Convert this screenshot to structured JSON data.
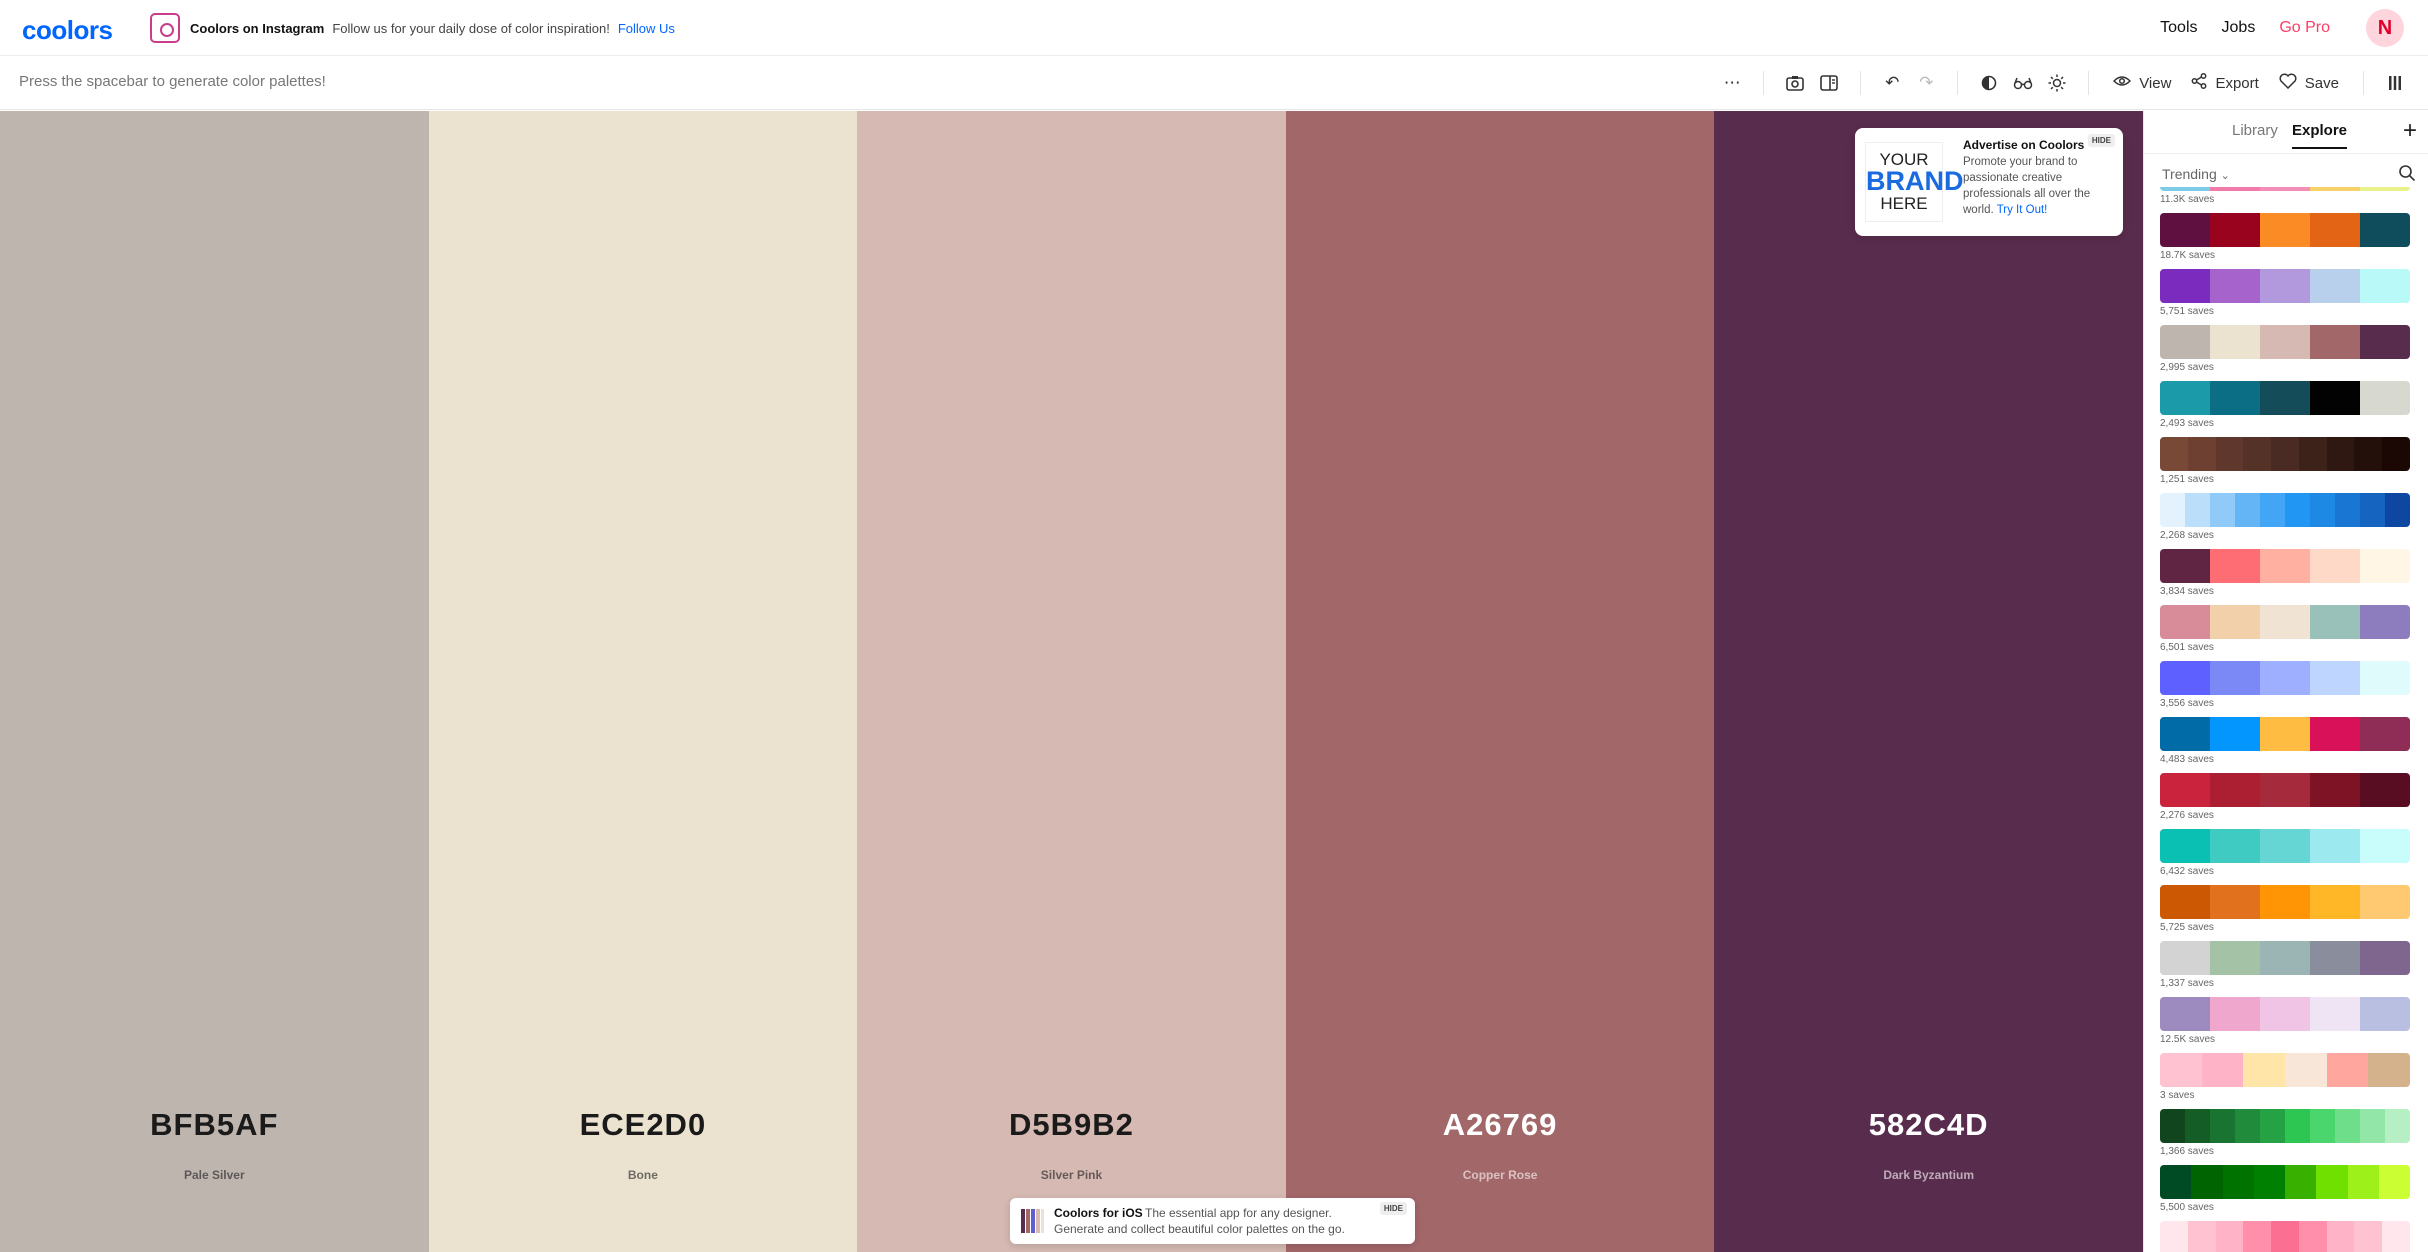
{
  "header": {
    "logo": "coolors",
    "promo_title": "Coolors on Instagram",
    "promo_text": "Follow us for your daily dose of color inspiration!",
    "promo_link": "Follow Us",
    "nav": [
      "Tools",
      "Jobs",
      "Go Pro"
    ],
    "avatar_initial": "N"
  },
  "toolbar": {
    "hint": "Press the spacebar to generate color palettes!",
    "view_label": "View",
    "export_label": "Export",
    "save_label": "Save"
  },
  "palette": [
    {
      "hex": "BFB5AF",
      "name": "Pale Silver",
      "color": "#BFB5AF",
      "text": "#1a1a1a"
    },
    {
      "hex": "ECE2D0",
      "name": "Bone",
      "color": "#ECE2D0",
      "text": "#1a1a1a"
    },
    {
      "hex": "D5B9B2",
      "name": "Silver Pink",
      "color": "#D5B9B2",
      "text": "#1a1a1a"
    },
    {
      "hex": "A26769",
      "name": "Copper Rose",
      "color": "#A26769",
      "text": "#ffffff"
    },
    {
      "hex": "582C4D",
      "name": "Dark Byzantium",
      "color": "#582C4D",
      "text": "#ffffff"
    }
  ],
  "ad": {
    "hide": "HIDE",
    "brand_line1": "YOUR",
    "brand_line2": "BRAND",
    "brand_line3": "HERE",
    "title": "Advertise on Coolors",
    "text": "Promote your brand to passionate creative professionals all over the world.",
    "link": "Try It Out!"
  },
  "ios_banner": {
    "title": "Coolors for iOS",
    "text1": "The essential app for any designer.",
    "text2": "Generate and collect beautiful color palettes on the go.",
    "hide": "HIDE"
  },
  "panel": {
    "tabs": [
      "Library",
      "Explore"
    ],
    "active_tab": "Explore",
    "filter": "Trending",
    "palettes": [
      {
        "saves": "11.3K saves",
        "colors": [
          "#7ecbe8",
          "#f07aa8",
          "#f38fb7",
          "#f6d16a",
          "#e9f28a"
        ],
        "partial": true
      },
      {
        "saves": "18.7K saves",
        "colors": [
          "#5f0f40",
          "#9a031e",
          "#fb8b24",
          "#e36414",
          "#0f4c5c"
        ]
      },
      {
        "saves": "5,751 saves",
        "colors": [
          "#7b2cbf",
          "#a663cc",
          "#b298dc",
          "#b8d0eb",
          "#b9faf8"
        ]
      },
      {
        "saves": "2,995 saves",
        "colors": [
          "#bfb5af",
          "#ece2d0",
          "#d5b9b2",
          "#a26769",
          "#582c4d"
        ]
      },
      {
        "saves": "2,493 saves",
        "colors": [
          "#1b9aaa",
          "#0b6e85",
          "#154c5a",
          "#020202",
          "#d7d9d0"
        ]
      },
      {
        "saves": "1,251 saves",
        "colors": [
          "#774936",
          "#6e4032",
          "#60372c",
          "#553228",
          "#4a2b24",
          "#3c2219",
          "#2f1812",
          "#23100a",
          "#1b0704"
        ]
      },
      {
        "saves": "2,268 saves",
        "colors": [
          "#e3f2fd",
          "#bbdefb",
          "#90caf9",
          "#64b5f6",
          "#42a5f5",
          "#2196f3",
          "#1e88e5",
          "#1976d2",
          "#1565c0",
          "#0d47a1"
        ]
      },
      {
        "saves": "3,834 saves",
        "colors": [
          "#5f2542",
          "#fe6d73",
          "#ffb0a0",
          "#ffd9c8",
          "#fff6e6"
        ]
      },
      {
        "saves": "6,501 saves",
        "colors": [
          "#d88c9a",
          "#f2d0a9",
          "#f1e3d3",
          "#99c1b9",
          "#8e7dbe"
        ]
      },
      {
        "saves": "3,556 saves",
        "colors": [
          "#5e60ff",
          "#7b89f7",
          "#9fafff",
          "#bed5ff",
          "#e0fbfc"
        ]
      },
      {
        "saves": "4,483 saves",
        "colors": [
          "#006ba6",
          "#0496ff",
          "#ffbc42",
          "#d81159",
          "#8f2d56"
        ]
      },
      {
        "saves": "2,276 saves",
        "colors": [
          "#c9233e",
          "#ac1e32",
          "#a52a3b",
          "#7d1325",
          "#590d22"
        ]
      },
      {
        "saves": "6,432 saves",
        "colors": [
          "#0ac0b3",
          "#3fcbc1",
          "#66d6d4",
          "#9ce9ef",
          "#c9fdfb"
        ]
      },
      {
        "saves": "5,725 saves",
        "colors": [
          "#cc5803",
          "#e2711d",
          "#ff9505",
          "#ffb627",
          "#ffc971"
        ]
      },
      {
        "saves": "1,337 saves",
        "colors": [
          "#d3d3d3",
          "#a4c3a6",
          "#9ab5b3",
          "#8a8e9c",
          "#7e668e"
        ]
      },
      {
        "saves": "12.5K saves",
        "colors": [
          "#9d8bc0",
          "#efa7cd",
          "#f0c4e5",
          "#efe4f4",
          "#b9bfe0"
        ]
      },
      {
        "saves": "3 saves",
        "colors": [
          "#ffc2d1",
          "#ffb3c6",
          "#ffe5a8",
          "#f8e7d9",
          "#ffa69e",
          "#d4b28c"
        ]
      },
      {
        "saves": "1,366 saves",
        "colors": [
          "#10451d",
          "#155d27",
          "#1a7431",
          "#208b3a",
          "#25a244",
          "#2dc653",
          "#4ad66d",
          "#6ede8a",
          "#92e6a7",
          "#b7efc5"
        ]
      },
      {
        "saves": "5,500 saves",
        "colors": [
          "#004b23",
          "#006400",
          "#007200",
          "#008000",
          "#38b000",
          "#70e000",
          "#9ef01a",
          "#ccff33"
        ]
      },
      {
        "saves": "",
        "colors": [
          "#ffe5ec",
          "#ffc2d1",
          "#ffb3c6",
          "#ff8fab",
          "#fb6f92",
          "#ff8fab",
          "#ffb3c6",
          "#ffc2d1",
          "#ffe5ec"
        ]
      }
    ]
  }
}
